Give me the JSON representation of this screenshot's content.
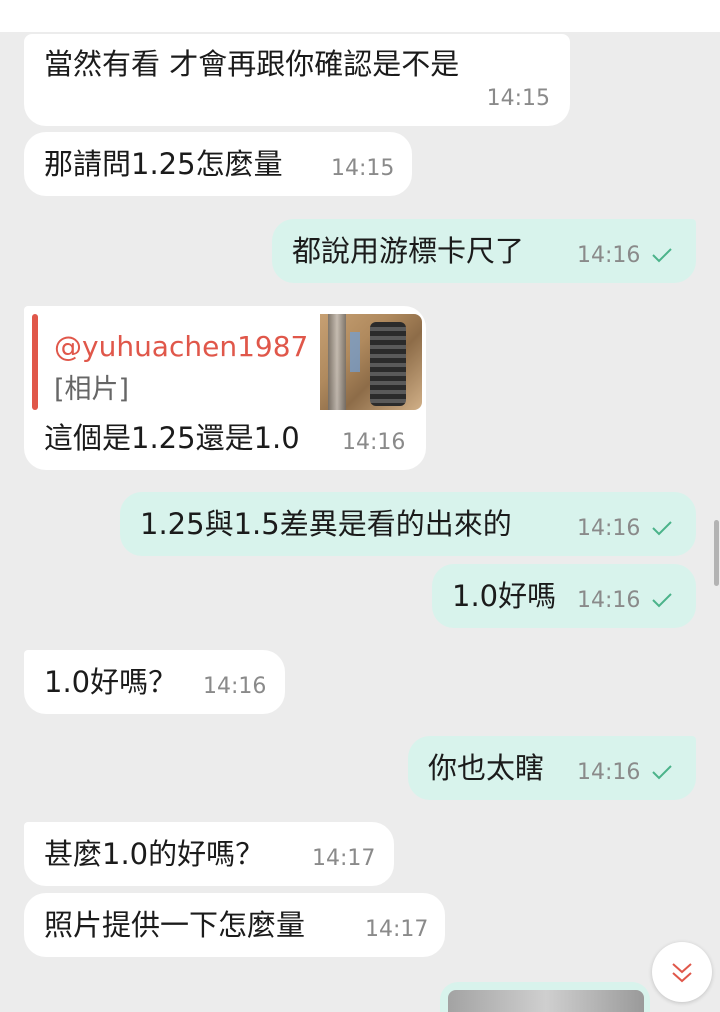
{
  "messages": [
    {
      "dir": "in",
      "text": "當然有看 才會再跟你確認是不是",
      "time": "14:15"
    },
    {
      "dir": "in",
      "text": "那請問1.25怎麼量",
      "time": "14:15"
    },
    {
      "dir": "out",
      "text": "都說用游標卡尺了",
      "time": "14:16"
    },
    {
      "dir": "in",
      "text": "這個是1.25還是1.0",
      "time": "14:16",
      "reply": {
        "user": "@yuhuachen1987",
        "kind": "[相片]"
      }
    },
    {
      "dir": "out",
      "text": "1.25與1.5差異是看的出來的",
      "time": "14:16"
    },
    {
      "dir": "out",
      "text": "1.0好嗎",
      "time": "14:16"
    },
    {
      "dir": "in",
      "text": "1.0好嗎？",
      "time": "14:16"
    },
    {
      "dir": "out",
      "text": "你也太瞎",
      "time": "14:16"
    },
    {
      "dir": "in",
      "text": "甚麼1.0的好嗎？",
      "time": "14:17"
    },
    {
      "dir": "in",
      "text": "照片提供一下怎麼量",
      "time": "14:17"
    }
  ],
  "colors": {
    "incoming": "#ffffff",
    "outgoing": "#d8f3ec",
    "reply_accent": "#e0574a",
    "check": "#4bb38a"
  },
  "icons": {
    "sent": "check-icon",
    "scroll": "double-chevron-down-icon"
  }
}
